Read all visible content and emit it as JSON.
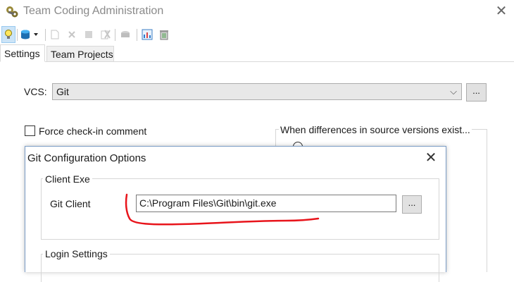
{
  "window": {
    "title": "Team Coding Administration",
    "close_glyph": "✕",
    "app_icon": "gears-icon"
  },
  "toolbar": {
    "items": [
      {
        "name": "lightbulb-icon",
        "state": "selected"
      },
      {
        "name": "database-dropdown-icon"
      },
      {
        "name": "new-document-icon",
        "state": "disabled"
      },
      {
        "name": "delete-icon",
        "state": "disabled"
      },
      {
        "name": "stop-icon",
        "state": "disabled"
      },
      {
        "name": "cancel-icon",
        "state": "disabled"
      },
      {
        "name": "checkin-icon",
        "state": "disabled"
      },
      {
        "name": "report-icon"
      },
      {
        "name": "recycle-bin-icon"
      }
    ]
  },
  "tabs": [
    {
      "label": "Settings",
      "active": true
    },
    {
      "label": "Team Projects",
      "active": false
    }
  ],
  "settings": {
    "vcs_label": "VCS:",
    "vcs_value": "Git",
    "vcs_arrow": "⌵",
    "vcs_more_label": "...",
    "force_checkin_label": "Force check-in comment",
    "force_checkin_checked": false,
    "differences_group_label": "When differences in source versions exist..."
  },
  "git_dialog": {
    "title": "Git Configuration Options",
    "close_glyph": "✕",
    "client_group_label": "Client Exe",
    "git_client_label": "Git Client",
    "git_client_value": "C:\\Program Files\\Git\\bin\\git.exe",
    "browse_label": "...",
    "login_group_label": "Login Settings"
  },
  "colors": {
    "annotation": "#e8141b",
    "dialog_border": "#7a9cc6",
    "selected_tool": "#cce4f7"
  }
}
